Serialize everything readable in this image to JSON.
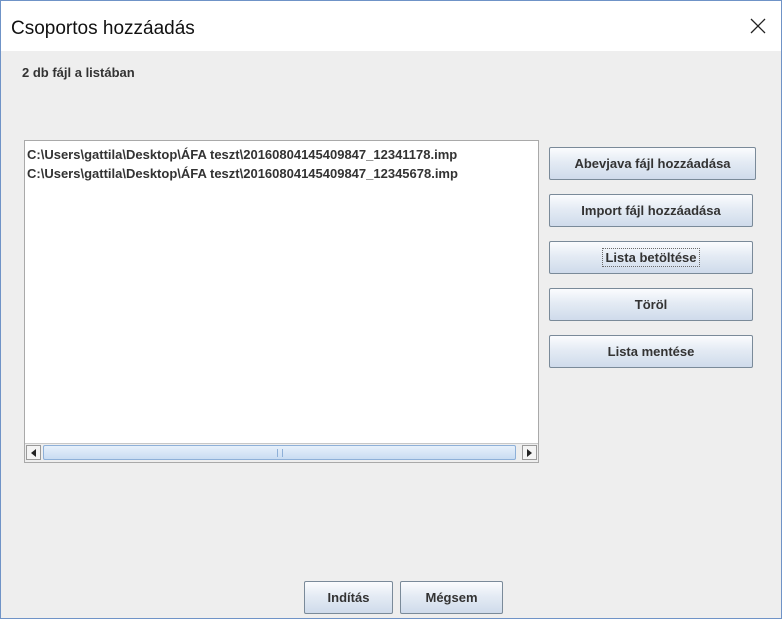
{
  "window": {
    "title": "Csoportos hozzáadás",
    "close_icon": "close-icon"
  },
  "status_text": "2 db fájl a listában",
  "file_list": [
    "C:\\Users\\gattila\\Desktop\\ÁFA teszt\\20160804145409847_12341178.imp",
    "C:\\Users\\gattila\\Desktop\\ÁFA teszt\\20160804145409847_12345678.imp"
  ],
  "side_buttons": {
    "add_abevjava": "Abevjava fájl hozzáadása",
    "add_import": "Import fájl hozzáadása",
    "load_list": "Lista betöltése",
    "delete": "Töröl",
    "save_list": "Lista mentése"
  },
  "bottom_buttons": {
    "start": "Indítás",
    "cancel": "Mégsem"
  },
  "colors": {
    "window_border": "#6f93c7",
    "panel_bg": "#eeeeee",
    "button_gradient_top": "#fbfcfe",
    "button_gradient_bottom": "#cfdbeb"
  }
}
